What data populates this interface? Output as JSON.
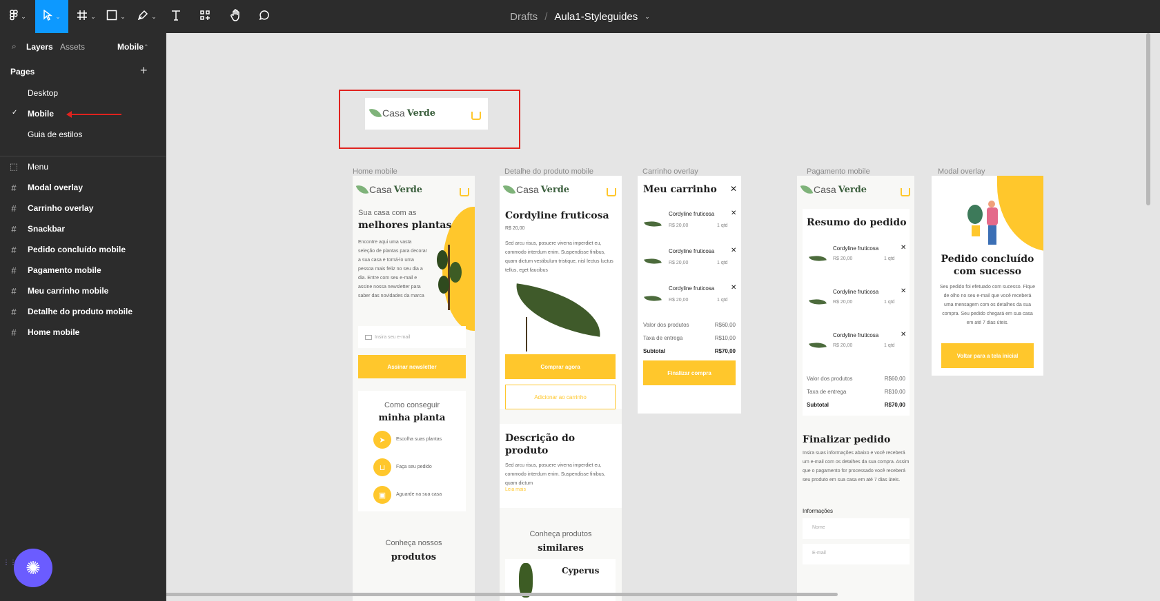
{
  "toolbar": {
    "breadcrumb_parent": "Drafts",
    "separator": "/",
    "file_name": "Aula1-Styleguides",
    "tools": [
      "figma-menu",
      "move",
      "frame",
      "shape",
      "pen",
      "text",
      "resources",
      "hand",
      "comment"
    ]
  },
  "sidebar": {
    "tabs": {
      "layers": "Layers",
      "assets": "Assets",
      "page_selector": "Mobile"
    },
    "pages_title": "Pages",
    "pages": [
      {
        "label": "Desktop"
      },
      {
        "label": "Mobile",
        "selected": true
      },
      {
        "label": "Guia de estilos"
      }
    ],
    "layers": [
      {
        "label": "Menu",
        "icon": "component-dashed-icon"
      },
      {
        "label": "Modal overlay",
        "icon": "frame-icon"
      },
      {
        "label": "Carrinho overlay",
        "icon": "frame-icon"
      },
      {
        "label": "Snackbar",
        "icon": "frame-icon"
      },
      {
        "label": "Pedido concluído mobile",
        "icon": "frame-icon"
      },
      {
        "label": "Pagamento mobile",
        "icon": "frame-icon"
      },
      {
        "label": "Meu carrinho mobile",
        "icon": "frame-icon"
      },
      {
        "label": "Detalhe do produto mobile",
        "icon": "frame-icon"
      },
      {
        "label": "Home mobile",
        "icon": "frame-icon"
      }
    ]
  },
  "canvas": {
    "menu": {
      "brand_a": "Casa",
      "brand_b": "Verde"
    },
    "frame_labels": {
      "home": "Home mobile",
      "detail": "Detalhe do produto mobile",
      "cart": "Carrinho overlay",
      "payment": "Pagamento mobile",
      "modal": "Modal overlay"
    },
    "home": {
      "intro": "Sua casa com as",
      "headline": "melhores plantas",
      "body": "Encontre aqui uma vasta seleção de plantas para decorar a sua casa e torná-lo uma pessoa mais feliz no seu dia a dia. Entre com seu e-mail e assine nossa newsletter para saber das novidades da marca",
      "email_placeholder": "Insira seu e-mail",
      "subscribe": "Assinar newsletter",
      "how_intro": "Como conseguir",
      "how_title": "minha planta",
      "steps": [
        "Escolha suas plantas",
        "Faça seu pedido",
        "Aguarde na sua casa"
      ],
      "know_intro": "Conheça nossos",
      "know_title": "produtos"
    },
    "detail": {
      "title": "Cordyline fruticosa",
      "price": "R$ 20,00",
      "body": "Sed arcu risus, posuere viverra imperdiet eu, commodo interdum enim. Suspendisse finibus, quam dictum vestibulum tristique, nisl lectus luctus tellus, eget faucibus",
      "buy": "Comprar agora",
      "add": "Adicionar ao carrinho",
      "desc_title": "Descrição do produto",
      "desc_body": "Sed arcu risus, posuere viverra imperdiet eu, commodo interdum enim. Suspendisse finibus, quam dictum",
      "read_more": "Leia mais",
      "similar_intro": "Conheça produtos",
      "similar_title": "similares",
      "similar_item": "Cyperus"
    },
    "cart": {
      "title": "Meu carrinho",
      "items": [
        {
          "name": "Cordyline fruticosa",
          "price": "R$ 20,00",
          "qty": "1 qtd"
        },
        {
          "name": "Cordyline fruticosa",
          "price": "R$ 20,00",
          "qty": "1 qtd"
        },
        {
          "name": "Cordyline fruticosa",
          "price": "R$ 20,00",
          "qty": "1 qtd"
        }
      ],
      "products_label": "Valor dos produtos",
      "products_value": "R$60,00",
      "shipping_label": "Taxa de entrega",
      "shipping_value": "R$10,00",
      "subtotal_label": "Subtotal",
      "subtotal_value": "R$70,00",
      "finish": "Finalizar compra"
    },
    "payment": {
      "summary_title": "Resumo do pedido",
      "finish_title": "Finalizar pedido",
      "finish_body": "Insira suas informações abaixo e você receberá um e-mail com os detalhes da sua compra. Assim que o pagamento for processado você receberá seu produto em sua casa em até 7 dias úteis.",
      "info_label": "Informações",
      "name_placeholder": "Nome",
      "email_placeholder": "E-mail"
    },
    "modal": {
      "title": "Pedido concluído com sucesso",
      "body": "Seu pedido foi efetuado com sucesso. Fique de olho no seu e-mail que você receberá uma mensagem com os detalhes da sua compra. Seu pedido chegará em sua casa em até 7 dias úteis.",
      "back": "Voltar para a tela inicial"
    }
  },
  "colors": {
    "accent": "#ffc72c",
    "figma_blue": "#0d99ff",
    "annotation_red": "#e0221e",
    "brand_green": "#3b5f3d"
  }
}
